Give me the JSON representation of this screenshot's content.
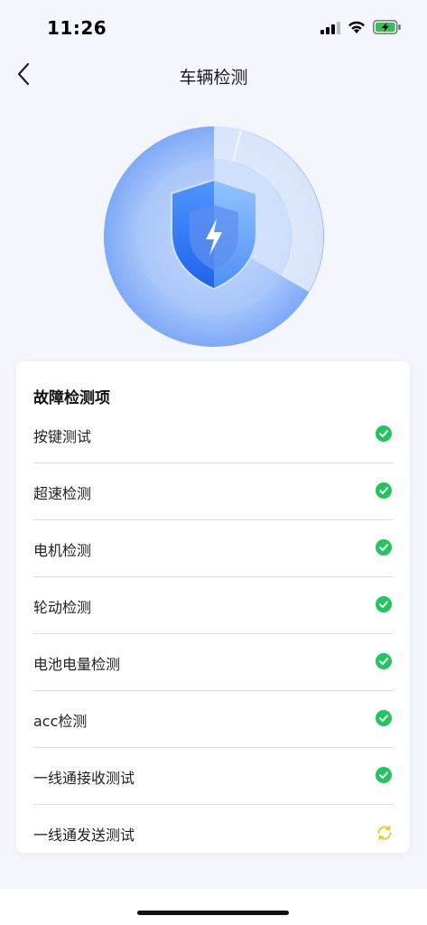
{
  "status_bar": {
    "time": "11:26",
    "icons": [
      "cellular-signal-icon",
      "wifi-icon",
      "battery-charging-icon"
    ]
  },
  "nav": {
    "back_icon": "chevron-left-icon",
    "title": "车辆检测"
  },
  "hero": {
    "icon": "shield-lightning-icon"
  },
  "fault_card": {
    "title": "故障检测项",
    "items": [
      {
        "label": "按键测试",
        "status": "passed"
      },
      {
        "label": "超速检测",
        "status": "passed"
      },
      {
        "label": "电机检测",
        "status": "passed"
      },
      {
        "label": "轮动检测",
        "status": "passed"
      },
      {
        "label": "电池电量检测",
        "status": "passed"
      },
      {
        "label": "acc检测",
        "status": "passed"
      },
      {
        "label": "一线通接收测试",
        "status": "passed"
      },
      {
        "label": "一线通发送测试",
        "status": "in-progress"
      }
    ]
  },
  "colors": {
    "success": "#22c55e",
    "pending": "#f5c518",
    "shield_blue": "#2f7bf5",
    "background": "#f3f6fc"
  }
}
